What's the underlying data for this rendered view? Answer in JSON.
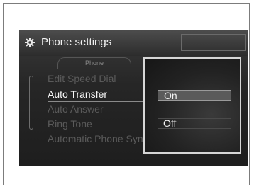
{
  "title": "Phone settings",
  "tab_label": "Phone",
  "menu_items": [
    {
      "label": "Edit Speed Dial",
      "active": false
    },
    {
      "label": "Auto Transfer",
      "active": true
    },
    {
      "label": "Auto Answer",
      "active": false
    },
    {
      "label": "Ring Tone",
      "active": false
    },
    {
      "label": "Automatic Phone Sync",
      "active": false
    }
  ],
  "options": [
    {
      "label": "On",
      "selected": true
    },
    {
      "label": "Off",
      "selected": false
    }
  ],
  "icons": {
    "title": "gear-icon"
  }
}
